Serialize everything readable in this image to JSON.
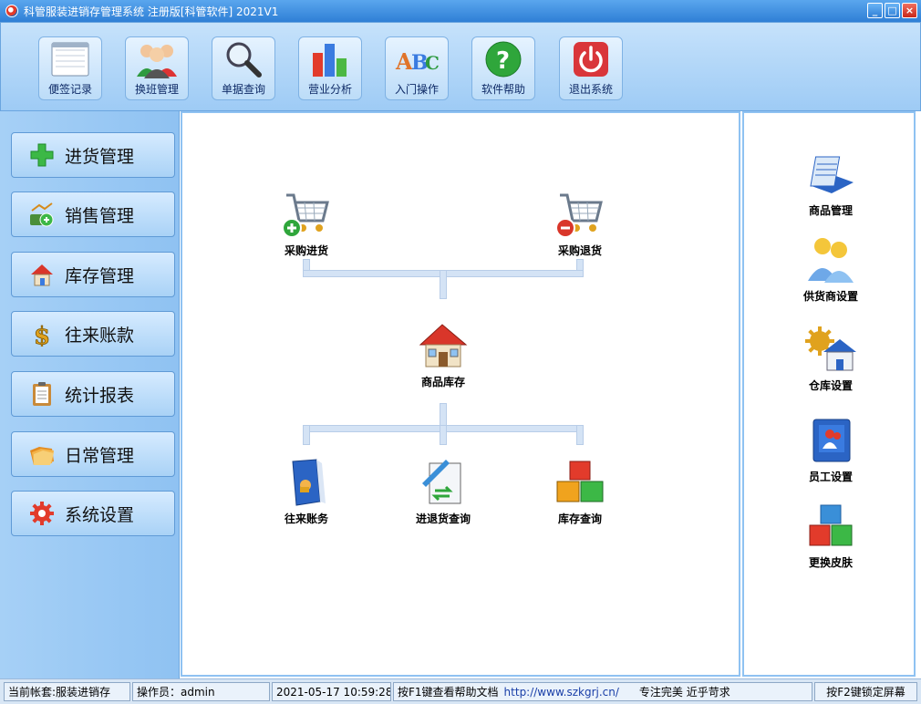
{
  "window": {
    "title": "科管服装进销存管理系统 注册版[科管软件] 2021V1",
    "buttons": {
      "minimize": "_",
      "maximize": "□",
      "close": "×"
    }
  },
  "toolbar": {
    "items": [
      {
        "label": "便签记录",
        "icon": "notepad-icon"
      },
      {
        "label": "换班管理",
        "icon": "users-icon"
      },
      {
        "label": "单据查询",
        "icon": "magnifier-icon"
      },
      {
        "label": "营业分析",
        "icon": "bar-chart-icon"
      },
      {
        "label": "入门操作",
        "icon": "abc-icon"
      },
      {
        "label": "软件帮助",
        "icon": "help-icon"
      },
      {
        "label": "退出系统",
        "icon": "power-icon"
      }
    ]
  },
  "sidebar": {
    "items": [
      {
        "label": "进货管理",
        "icon": "plus-icon"
      },
      {
        "label": "销售管理",
        "icon": "sales-icon"
      },
      {
        "label": "库存管理",
        "icon": "house-icon"
      },
      {
        "label": "往来账款",
        "icon": "dollar-icon"
      },
      {
        "label": "统计报表",
        "icon": "clipboard-icon"
      },
      {
        "label": "日常管理",
        "icon": "folders-icon"
      },
      {
        "label": "系统设置",
        "icon": "gear-icon"
      }
    ]
  },
  "flow": {
    "purchase_in": "采购进货",
    "purchase_return": "采购退货",
    "inventory": "商品库存",
    "accounts": "往来账务",
    "io_query": "进退货查询",
    "stock_query": "库存查询"
  },
  "right_panel": {
    "items": [
      {
        "label": "商品管理"
      },
      {
        "label": "供货商设置"
      },
      {
        "label": "仓库设置"
      },
      {
        "label": "员工设置"
      },
      {
        "label": "更换皮肤"
      }
    ]
  },
  "status": {
    "account": "当前帐套:服装进销存",
    "operator": "操作员：admin",
    "datetime": "2021-05-17 10:59:28",
    "help_hint": "按F1键查看帮助文档",
    "url": "http://www.szkgrj.cn/",
    "slogan": "专注完美 近乎苛求",
    "lock_hint": "按F2键锁定屏幕"
  },
  "colors": {
    "accent": "#2f7fd6",
    "panel": "#a6d0f6",
    "pipe": "#d4e3f5"
  }
}
